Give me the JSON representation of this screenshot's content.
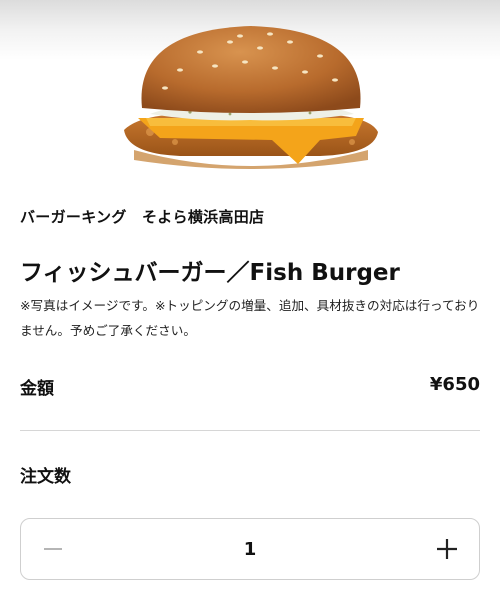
{
  "product": {
    "store_name": "バーガーキング　そよら横浜高田店",
    "title": "フィッシュバーガー／Fish Burger",
    "note": "※写真はイメージです。※トッピングの増量、追加、具材抜きの対応は行っておりません。予めご了承ください。"
  },
  "price": {
    "label": "金額",
    "value": "¥650"
  },
  "quantity": {
    "label": "注文数",
    "value": "1"
  },
  "icons": {
    "decrement": "minus-icon",
    "increment": "plus-icon"
  }
}
